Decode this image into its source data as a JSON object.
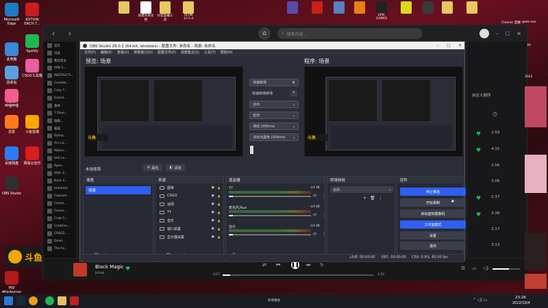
{
  "desktop": {
    "icons": [
      {
        "label": "Microsoft Edge",
        "color": "#1e7ac4"
      },
      {
        "label": "此电脑",
        "color": "#3a88d8"
      },
      {
        "label": "回收站",
        "color": "#5aa0e0"
      },
      {
        "label": "哔哩哔哩",
        "color": "#f25d8e"
      },
      {
        "label": "迅雷",
        "color": "#ff7a1a"
      },
      {
        "label": "百度网盘",
        "color": "#2f7bf6"
      },
      {
        "label": "OBS Studio",
        "color": "#303030"
      },
      {
        "label": "MSI Afterburner",
        "color": "#b41a1a"
      }
    ],
    "col2": [
      {
        "label": "KOTION EACH 7...",
        "color": "#c81e1e"
      },
      {
        "label": "Spotify",
        "color": "#1db954"
      },
      {
        "label": "CSGO工具箱",
        "color": "#e85fa0"
      },
      {
        "label": "斗鱼直播",
        "color": "#f7a600"
      },
      {
        "label": "网易云音乐",
        "color": "#d81e1e"
      }
    ],
    "top_icons": [
      {
        "label": "",
        "color": "#e8c860"
      },
      {
        "label": "新建文本文档",
        "color": "#ffffff"
      },
      {
        "label": "抖音直播工具",
        "color": "#e8c860"
      },
      {
        "label": "ULAN 13.5.4",
        "color": "#e8c860"
      },
      {
        "label": "",
        "color": "#5a4aa8"
      },
      {
        "label": "",
        "color": "#c8201a"
      },
      {
        "label": "",
        "color": "#5a80c0"
      },
      {
        "label": "",
        "color": "#e88018"
      },
      {
        "label": "EPIC GAMES",
        "color": "#222222"
      },
      {
        "label": "",
        "color": "#d8d820"
      },
      {
        "label": "",
        "color": "#3a3a3a"
      },
      {
        "label": "",
        "color": "#e8c860"
      },
      {
        "label": "",
        "color": "#e8c860"
      }
    ],
    "right_labels": [
      "Cleaner 直播",
      "geek.exe",
      "Ks",
      "2022"
    ],
    "douyu_logo": "斗鱼"
  },
  "music": {
    "search_placeholder": "搜索内容...",
    "sidebar": [
      {
        "label": "首页"
      },
      {
        "label": "浏览"
      },
      {
        "label": "我的音乐"
      },
      {
        "label": "ARK 5..."
      },
      {
        "label": "INSTRUCTI..."
      },
      {
        "label": "Counter..."
      },
      {
        "label": "Cozy 7..."
      },
      {
        "label": "Grand..."
      },
      {
        "label": "歌单"
      },
      {
        "label": "7 Days..."
      },
      {
        "label": "跑跑..."
      },
      {
        "label": "猫猫"
      },
      {
        "label": "Dying..."
      },
      {
        "label": "Arn La..."
      },
      {
        "label": "Albion..."
      },
      {
        "label": "Hell Le..."
      },
      {
        "label": "Apex..."
      },
      {
        "label": "ARK: S..."
      },
      {
        "label": "Back 4..."
      },
      {
        "label": "beholder"
      },
      {
        "label": "Capcom..."
      },
      {
        "label": "Conan..."
      },
      {
        "label": "Conan..."
      },
      {
        "label": "Crab G..."
      },
      {
        "label": "Creative..."
      },
      {
        "label": "CRSED..."
      },
      {
        "label": "Dead..."
      },
      {
        "label": "The Fo..."
      }
    ],
    "right": {
      "sort_label": "自定义顺序",
      "tracks": [
        {
          "liked": true,
          "duration": "2:59"
        },
        {
          "liked": true,
          "duration": "4:15"
        },
        {
          "liked": false,
          "duration": "2:56"
        },
        {
          "liked": false,
          "duration": "3:08"
        },
        {
          "liked": true,
          "duration": "1:37"
        },
        {
          "liked": true,
          "duration": "3:38"
        },
        {
          "liked": false,
          "duration": "2:17"
        },
        {
          "liked": false,
          "duration": "3:13"
        }
      ]
    },
    "player": {
      "song": "Black Magic",
      "artist": "Jonas",
      "elapsed": "0:07",
      "total": "2:54",
      "progress": 0.05,
      "volume": 0.6
    }
  },
  "obs": {
    "title": "OBS Studio 28.0.2 (64-bit, windows) - 配置文件: 未命名 - 场景: 未命名",
    "menu": [
      "文件(F)",
      "编辑(E)",
      "查看(V)",
      "停靠窗口(D)",
      "配置文件(P)",
      "场景集合(S)",
      "工具(T)",
      "帮助(H)"
    ],
    "preview_label": "预览: 场景",
    "program_label": "程序: 场景",
    "transition": {
      "quick_btn": "快速转场",
      "transitions_label": "快速转场转场",
      "fade": "淡出",
      "cut": "剪切",
      "swipe": "滑动 (300ms)",
      "stinger": "淡出为黑色 (300ms)"
    },
    "no_source": "未选择源",
    "props_btn": "属性",
    "filters_btn": "滤镜",
    "docks": {
      "scenes": {
        "title": "场景",
        "items": [
          "场景"
        ]
      },
      "sources": {
        "title": "来源",
        "items": [
          "图像",
          "CSGO",
          "运网",
          "YY",
          "音乐",
          "窗口采集",
          "显示器采集"
        ]
      },
      "mixer": {
        "title": "混音器",
        "channels": [
          {
            "name": "YY",
            "db": "-inf dB",
            "level": 0.05
          },
          {
            "name": "麦克风/Aux",
            "db": "-inf dB",
            "level": 0.05
          },
          {
            "name": "音乐",
            "db": "-inf dB",
            "level": 0.05
          }
        ]
      },
      "transitions": {
        "title": "转场特效",
        "value": "淡出"
      },
      "controls": {
        "title": "控件",
        "buttons": [
          {
            "label": "停止推流",
            "blue": true
          },
          {
            "label": "开始录制",
            "blue": false
          },
          {
            "label": "启动虚拟摄像机",
            "blue": false
          },
          {
            "label": "工作室模式",
            "blue": true
          },
          {
            "label": "设置",
            "blue": false
          },
          {
            "label": "退出",
            "blue": false
          }
        ]
      }
    },
    "status": {
      "live": "LIVE: 00:00:00",
      "rec": "REC: 00:00:00",
      "cpu": "CPU: 0.9%, 60.00 fps"
    }
  },
  "taskbar": {
    "time": "23:26",
    "date": "2022/10/4",
    "active_label": "新增播放"
  }
}
